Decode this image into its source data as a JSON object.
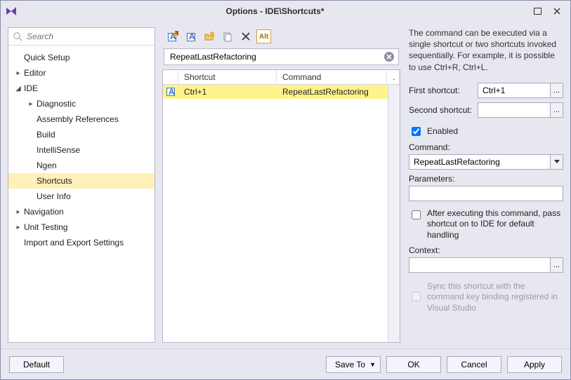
{
  "window": {
    "title": "Options - IDE\\Shortcuts*"
  },
  "search": {
    "placeholder": "Search"
  },
  "tree": [
    {
      "label": "Quick Setup",
      "level": 0,
      "caret": "",
      "selected": false
    },
    {
      "label": "Editor",
      "level": 0,
      "caret": "▸",
      "selected": false
    },
    {
      "label": "IDE",
      "level": 0,
      "caret": "◢",
      "selected": false
    },
    {
      "label": "Diagnostic",
      "level": 1,
      "caret": "▸",
      "selected": false
    },
    {
      "label": "Assembly References",
      "level": 1,
      "caret": "",
      "selected": false
    },
    {
      "label": "Build",
      "level": 1,
      "caret": "",
      "selected": false
    },
    {
      "label": "IntelliSense",
      "level": 1,
      "caret": "",
      "selected": false
    },
    {
      "label": "Ngen",
      "level": 1,
      "caret": "",
      "selected": false
    },
    {
      "label": "Shortcuts",
      "level": 1,
      "caret": "",
      "selected": true
    },
    {
      "label": "User Info",
      "level": 1,
      "caret": "",
      "selected": false
    },
    {
      "label": "Navigation",
      "level": 0,
      "caret": "▸",
      "selected": false
    },
    {
      "label": "Unit Testing",
      "level": 0,
      "caret": "▸",
      "selected": false
    },
    {
      "label": "Import and Export Settings",
      "level": 0,
      "caret": "",
      "selected": false
    }
  ],
  "filter": {
    "value": "RepeatLastRefactoring"
  },
  "grid": {
    "headers": {
      "shortcut": "Shortcut",
      "command": "Command"
    },
    "rows": [
      {
        "shortcut": "Ctrl+1",
        "command": "RepeatLastRefactoring",
        "selected": true
      }
    ]
  },
  "panel": {
    "description": "The command can be executed via a single shortcut or two shortcuts invoked sequentially. For example, it is possible to use Ctrl+R, Ctrl+L.",
    "first_label": "First shortcut:",
    "first_value": "Ctrl+1",
    "second_label": "Second shortcut:",
    "second_value": "",
    "enabled_label": "Enabled",
    "enabled_checked": true,
    "command_label": "Command:",
    "command_value": "RepeatLastRefactoring",
    "parameters_label": "Parameters:",
    "parameters_value": "",
    "pass_label": "After executing this command, pass shortcut on to IDE for default handling",
    "pass_checked": false,
    "context_label": "Context:",
    "context_value": "",
    "sync_label": "Sync this shortcut with the command key binding registered in Visual Studio"
  },
  "footer": {
    "default": "Default",
    "save_to": "Save To",
    "ok": "OK",
    "cancel": "Cancel",
    "apply": "Apply"
  },
  "toolbar_icons": {
    "alt": "Alt"
  }
}
